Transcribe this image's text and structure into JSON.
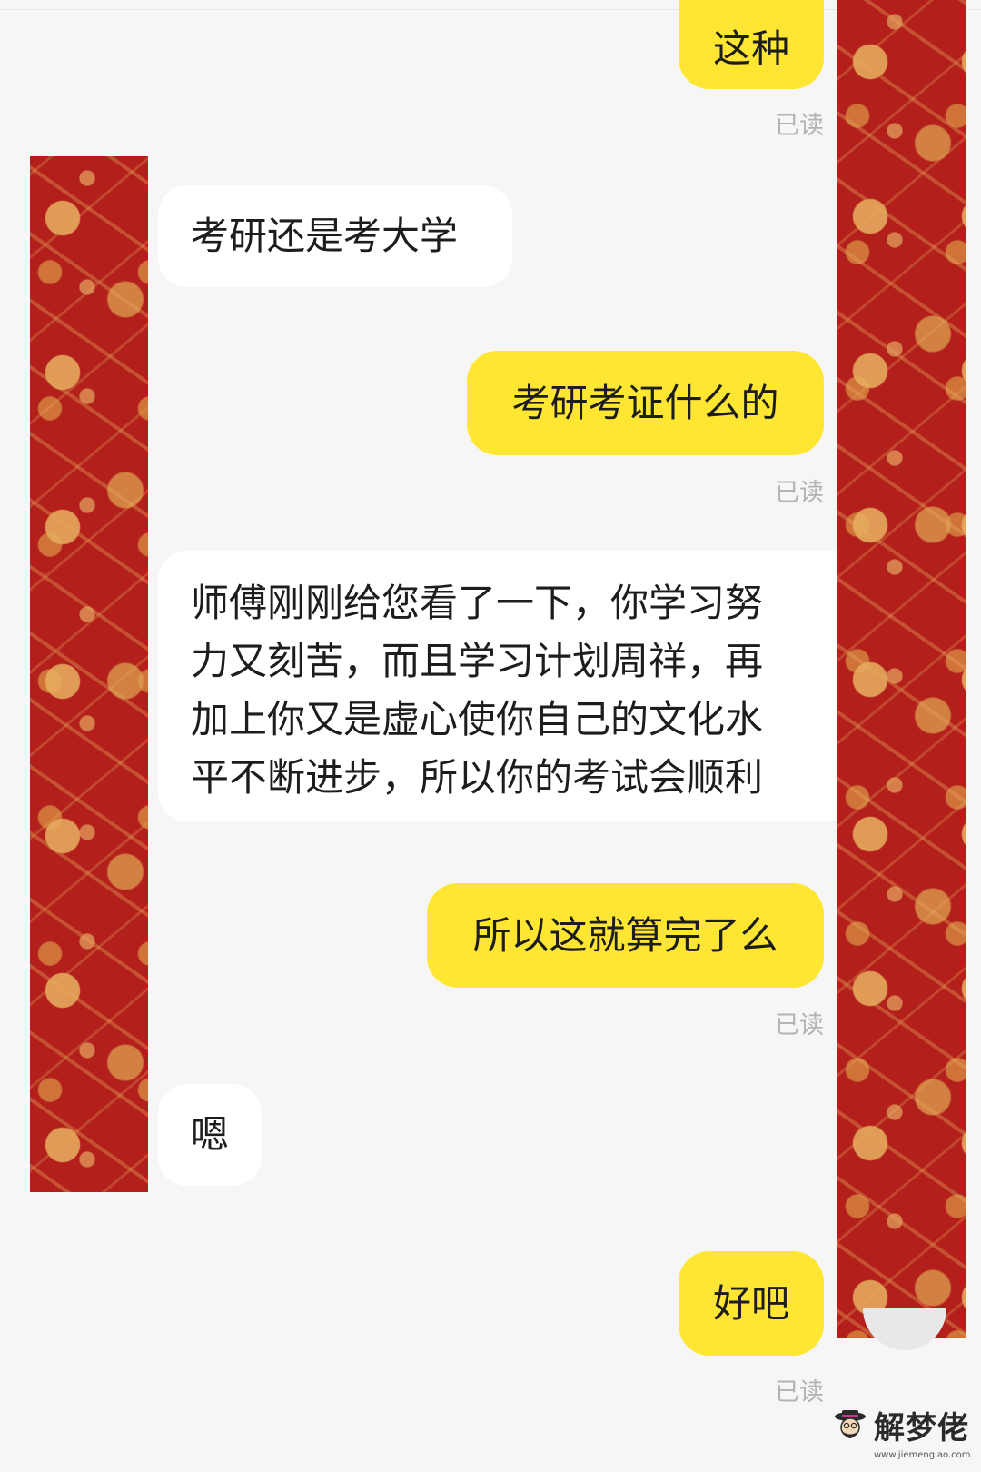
{
  "messages": [
    {
      "side": "out",
      "text": "这种",
      "status": "已读"
    },
    {
      "side": "in",
      "text": "考研还是考大学"
    },
    {
      "side": "out",
      "text": "考研考证什么的",
      "status": "已读"
    },
    {
      "side": "in",
      "lines": [
        "师傅刚刚给您看了一下，你学习努",
        "力又刻苦，而且学习计划周祥，再",
        "加上你又是虚心使你自己的文化水",
        "平不断进步，所以你的考试会顺利"
      ]
    },
    {
      "side": "out",
      "text": "所以这就算完了么",
      "status": "已读"
    },
    {
      "side": "in",
      "text": "嗯"
    },
    {
      "side": "out",
      "text": "好吧",
      "status": "已读"
    }
  ],
  "watermark": {
    "title": "解梦佬",
    "url": "www.jiemenglao.com"
  },
  "colors": {
    "outgoing_bubble": "#ffe633",
    "incoming_bubble": "#ffffff",
    "background": "#f6f6f6",
    "read_status": "#b3b3b3",
    "brocade_red": "#b3201c",
    "brocade_gold": "#e8b060"
  }
}
